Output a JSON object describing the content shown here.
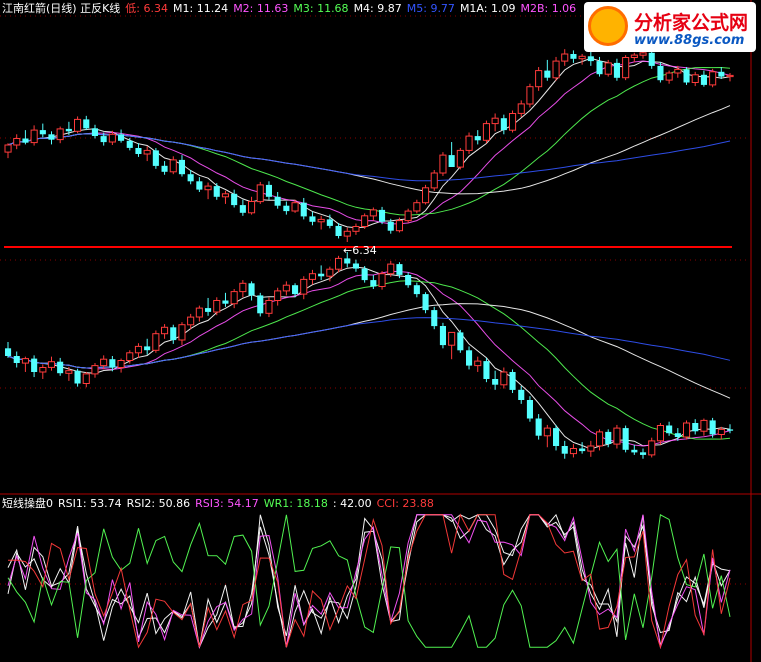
{
  "main_legend": [
    {
      "text": "江南红箭(日线) 正反K线",
      "color": "#ffffff"
    },
    {
      "text": "低: 6.34",
      "color": "#ff3b3b"
    },
    {
      "text": "M1: 11.24",
      "color": "#ffffff"
    },
    {
      "text": "M2: 11.63",
      "color": "#ff55ff"
    },
    {
      "text": "M3: 11.68",
      "color": "#55ff55"
    },
    {
      "text": "M4: 9.87",
      "color": "#ffffff"
    },
    {
      "text": "M5: 9.77",
      "color": "#3355ff"
    },
    {
      "text": "M1A: 1.09",
      "color": "#ffffff"
    },
    {
      "text": "M2B: 1.06",
      "color": "#ff55ff"
    }
  ],
  "indicator_legend": [
    {
      "text": "短线操盘0",
      "color": "#ffffff"
    },
    {
      "text": "RSI1: 53.74",
      "color": "#ffffff"
    },
    {
      "text": "RSI2: 50.86",
      "color": "#ffffff"
    },
    {
      "text": "RSI3: 54.17",
      "color": "#ff55ff"
    },
    {
      "text": "WR1: 18.18",
      "color": "#55ff55"
    },
    {
      "text": ": 42.00",
      "color": "#ffffff"
    },
    {
      "text": "CCI: 23.88",
      "color": "#ff3b3b"
    }
  ],
  "watermark": {
    "title": "分析家公式网",
    "url": "www.88gs.com"
  },
  "low_marker": "6.34",
  "colors": {
    "up": "#ff3b3b",
    "down": "#54ffff",
    "frame": "#b00000",
    "divider": "#ff0000"
  },
  "chart_data": {
    "type": "candlestick",
    "upper_panel": {
      "candles": [
        [
          7.85,
          8.0,
          7.75,
          7.97
        ],
        [
          7.97,
          8.15,
          7.9,
          8.08
        ],
        [
          8.08,
          8.22,
          7.98,
          8.01
        ],
        [
          8.01,
          8.3,
          7.96,
          8.22
        ],
        [
          8.22,
          8.33,
          8.1,
          8.15
        ],
        [
          8.15,
          8.2,
          7.98,
          8.06
        ],
        [
          8.06,
          8.28,
          8.0,
          8.24
        ],
        [
          8.24,
          8.36,
          8.14,
          8.2
        ],
        [
          8.2,
          8.45,
          8.17,
          8.4
        ],
        [
          8.4,
          8.46,
          8.22,
          8.25
        ],
        [
          8.25,
          8.31,
          8.08,
          8.12
        ],
        [
          8.12,
          8.18,
          7.96,
          8.02
        ],
        [
          8.02,
          8.21,
          7.97,
          8.15
        ],
        [
          8.15,
          8.23,
          8.01,
          8.04
        ],
        [
          8.04,
          8.09,
          7.88,
          7.92
        ],
        [
          7.92,
          8.0,
          7.77,
          7.82
        ],
        [
          7.82,
          7.95,
          7.7,
          7.88
        ],
        [
          7.88,
          7.92,
          7.57,
          7.62
        ],
        [
          7.62,
          7.7,
          7.47,
          7.52
        ],
        [
          7.52,
          7.78,
          7.48,
          7.72
        ],
        [
          7.72,
          7.8,
          7.44,
          7.48
        ],
        [
          7.48,
          7.55,
          7.31,
          7.36
        ],
        [
          7.36,
          7.43,
          7.18,
          7.22
        ],
        [
          7.22,
          7.34,
          7.06,
          7.28
        ],
        [
          7.28,
          7.33,
          7.05,
          7.1
        ],
        [
          7.1,
          7.2,
          6.98,
          7.15
        ],
        [
          7.15,
          7.22,
          6.92,
          6.96
        ],
        [
          6.96,
          7.05,
          6.78,
          6.83
        ],
        [
          6.83,
          7.1,
          6.8,
          7.02
        ],
        [
          7.02,
          7.35,
          6.98,
          7.3
        ],
        [
          7.3,
          7.36,
          7.05,
          7.1
        ],
        [
          7.1,
          7.18,
          6.9,
          6.95
        ],
        [
          6.95,
          7.02,
          6.8,
          6.86
        ],
        [
          6.86,
          7.05,
          6.83,
          7.0
        ],
        [
          7.0,
          7.08,
          6.72,
          6.77
        ],
        [
          6.77,
          6.85,
          6.62,
          6.68
        ],
        [
          6.68,
          6.78,
          6.55,
          6.72
        ],
        [
          6.72,
          6.8,
          6.57,
          6.61
        ],
        [
          6.61,
          6.66,
          6.4,
          6.44
        ],
        [
          6.44,
          6.58,
          6.34,
          6.52
        ],
        [
          6.52,
          6.65,
          6.46,
          6.6
        ],
        [
          6.6,
          6.82,
          6.56,
          6.78
        ],
        [
          6.78,
          6.92,
          6.7,
          6.88
        ],
        [
          6.88,
          6.93,
          6.64,
          6.68
        ],
        [
          6.68,
          6.73,
          6.48,
          6.53
        ],
        [
          6.53,
          6.75,
          6.5,
          6.7
        ],
        [
          6.7,
          6.9,
          6.66,
          6.86
        ],
        [
          6.86,
          7.05,
          6.82,
          7.0
        ],
        [
          7.0,
          7.3,
          6.97,
          7.25
        ],
        [
          7.25,
          7.55,
          7.2,
          7.5
        ],
        [
          7.5,
          7.85,
          7.45,
          7.8
        ],
        [
          7.8,
          8.02,
          7.7,
          7.6
        ],
        [
          7.6,
          7.92,
          7.56,
          7.88
        ],
        [
          7.88,
          8.18,
          7.82,
          8.12
        ],
        [
          8.12,
          8.22,
          7.98,
          8.05
        ],
        [
          8.05,
          8.38,
          8.0,
          8.33
        ],
        [
          8.33,
          8.5,
          8.2,
          8.42
        ],
        [
          8.42,
          8.48,
          8.15,
          8.22
        ],
        [
          8.22,
          8.55,
          8.18,
          8.5
        ],
        [
          8.5,
          8.72,
          8.44,
          8.66
        ],
        [
          8.66,
          9.0,
          8.6,
          8.95
        ],
        [
          8.95,
          9.28,
          8.88,
          9.22
        ],
        [
          9.22,
          9.4,
          9.05,
          9.1
        ],
        [
          9.1,
          9.45,
          9.05,
          9.38
        ],
        [
          9.38,
          9.58,
          9.3,
          9.5
        ],
        [
          9.5,
          9.56,
          9.35,
          9.42
        ],
        [
          9.42,
          9.5,
          9.32,
          9.46
        ],
        [
          9.46,
          9.55,
          9.3,
          9.38
        ],
        [
          9.38,
          9.45,
          9.12,
          9.16
        ],
        [
          9.16,
          9.4,
          9.12,
          9.35
        ],
        [
          9.35,
          9.42,
          9.05,
          9.1
        ],
        [
          9.1,
          9.48,
          9.06,
          9.44
        ],
        [
          9.44,
          9.52,
          9.36,
          9.48
        ],
        [
          9.48,
          9.58,
          9.42,
          9.52
        ],
        [
          9.52,
          9.56,
          9.25,
          9.3
        ],
        [
          9.3,
          9.36,
          9.02,
          9.06
        ],
        [
          9.06,
          9.22,
          9.0,
          9.18
        ],
        [
          9.18,
          9.3,
          9.1,
          9.24
        ],
        [
          9.24,
          9.28,
          8.98,
          9.02
        ],
        [
          9.02,
          9.2,
          8.96,
          9.15
        ],
        [
          9.15,
          9.22,
          8.95,
          8.98
        ],
        [
          8.98,
          9.25,
          8.94,
          9.2
        ],
        [
          9.2,
          9.28,
          9.08,
          9.12
        ],
        [
          9.12,
          9.18,
          9.04,
          9.14
        ]
      ],
      "series": [
        {
          "name": "M1",
          "color": "#ffffff"
        },
        {
          "name": "M2",
          "color": "#ff55ff"
        },
        {
          "name": "M3",
          "color": "#55ff55"
        },
        {
          "name": "M4",
          "color": "#ffffff"
        },
        {
          "name": "M5",
          "color": "#3355ff"
        }
      ]
    },
    "lower_panel": {
      "series": [
        {
          "name": "RSI1",
          "color": "#ffffff"
        },
        {
          "name": "RSI2",
          "color": "#ffffff"
        },
        {
          "name": "RSI3",
          "color": "#ff55ff"
        },
        {
          "name": "WR1",
          "color": "#55ff55"
        },
        {
          "name": "CCI",
          "color": "#ff3b3b"
        }
      ]
    }
  }
}
